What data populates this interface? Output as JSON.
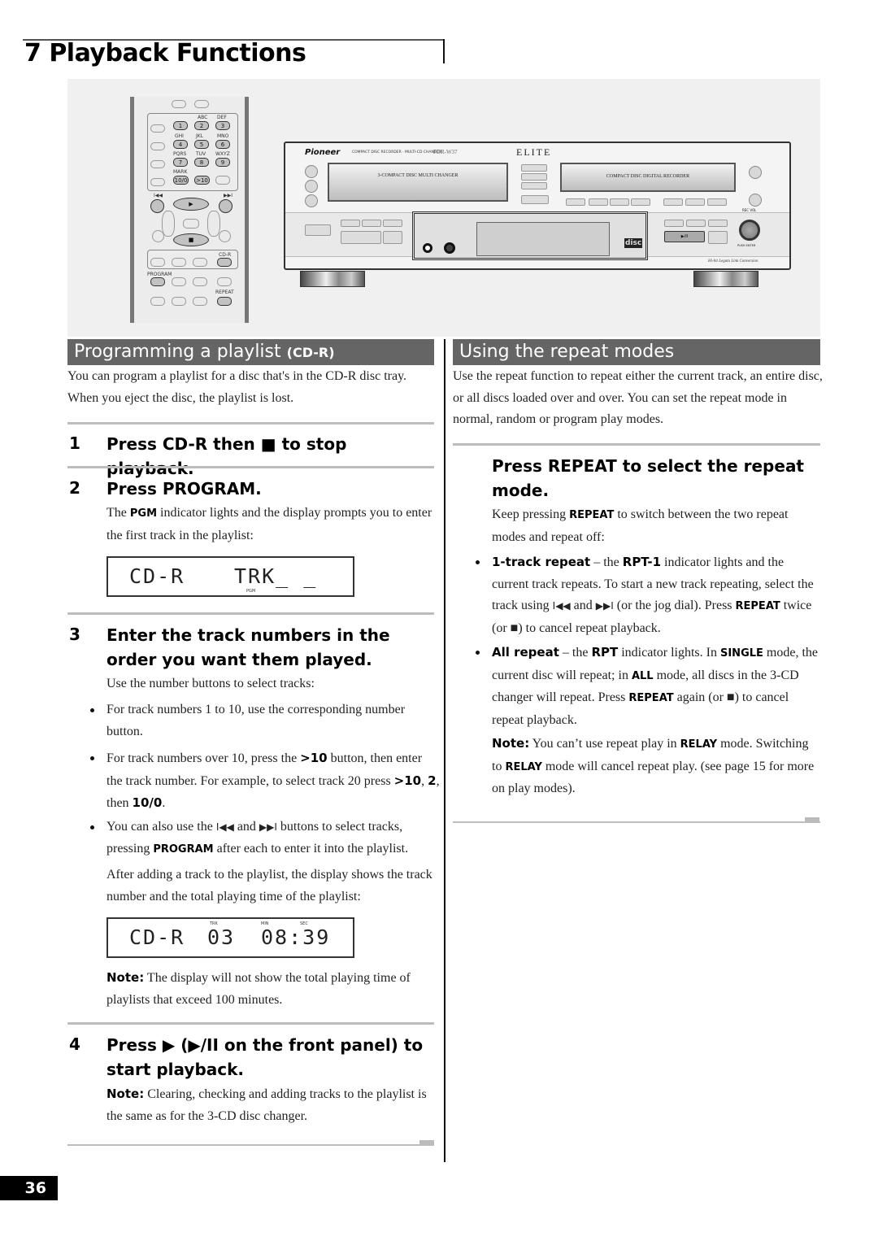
{
  "chapter": {
    "title": "7 Playback Functions"
  },
  "illustration": {
    "remote": {
      "letter_labels": [
        "ABC",
        "DEF",
        "GHI",
        "JKL",
        "MNO",
        "PQRS",
        "TUV",
        "WXYZ"
      ],
      "number_keys": [
        "1",
        "2",
        "3",
        "4",
        "5",
        "6",
        "7",
        "8",
        "9",
        "10/0",
        ">10"
      ],
      "mark_label": "MARK",
      "prev_label": "I◀◀",
      "next_label": "▶▶I",
      "play_label": "▶",
      "stop_label": "■",
      "cdr_label": "CD-R",
      "program_label": "PROGRAM",
      "repeat_label": "REPEAT"
    },
    "deck": {
      "brand": "Pioneer",
      "model_desc": "COMPACT DISC RECORDER · MULTI-CD CHANGER",
      "model": "PDR-W37",
      "elite": "ELITE",
      "changer_tray": "3-COMPACT DISC MULTI CHANGER",
      "recorder_tray": "COMPACT DISC DIGITAL RECORDER",
      "rec_vol": "REC VOL",
      "push_enter": "PUSH ENTER",
      "play_pause": "▶/II",
      "disc_logo": "disc",
      "legato": "Hi-bit Legato Link Conversion"
    }
  },
  "left": {
    "section_title": "Programming a playlist",
    "section_tag": "(CD-R)",
    "intro": "You can program a playlist for a disc that's in the CD-R disc tray. When you eject the disc, the playlist is lost.",
    "steps": [
      {
        "num": "1",
        "title": "Press CD-R then ■ to stop playback."
      },
      {
        "num": "2",
        "title": "Press PROGRAM.",
        "body_pre": "The ",
        "body_bold": "PGM",
        "body_post": " indicator lights and the display prompts you to enter the first track in the playlist:"
      },
      {
        "num": "3",
        "title": "Enter the track numbers in the order you want them played.",
        "body": "Use the number buttons to select tracks:",
        "bullets": [
          {
            "text": "For track numbers 1 to 10, use the corresponding number button."
          },
          {
            "p1": "For track numbers over 10, press the ",
            "b1": ">10",
            "p2": " button, then enter the track number. For example, to select track 20 press ",
            "b2": ">10",
            "p3": ", ",
            "b3": "2",
            "p4": ", then ",
            "b4": "10/0",
            "p5": "."
          },
          {
            "p1": "You can also use the ",
            "i1": "I◀◀",
            "p2": " and ",
            "i2": "▶▶I",
            "p3": " buttons to select tracks, pressing ",
            "b1": "PROGRAM",
            "p4": " after each to enter it into the playlist."
          }
        ],
        "after": "After adding a track to the playlist, the display shows the track number and the total playing time of the playlist:",
        "note_label": "Note:",
        "note": " The display will not show the total playing time of playlists that exceed 100 minutes."
      },
      {
        "num": "4",
        "title": "Press ▶ (▶/II on the front panel) to start playback.",
        "note_label": "Note:",
        "note": " Clearing, checking and adding tracks to the playlist is the same as for the 3-CD disc changer."
      }
    ],
    "lcd1": {
      "left": "CD-R",
      "right": "TRK_ _",
      "indicator": "PGM"
    },
    "lcd2": {
      "left": "CD-R",
      "track": "03",
      "time": "08:39",
      "trk_label": "TRK",
      "min_label": "MIN",
      "sec_label": "SEC"
    }
  },
  "right": {
    "section_title": "Using the repeat modes",
    "intro": "Use the repeat function to repeat either the current track, an entire disc, or all discs loaded over and over. You can set the repeat mode in normal, random or program play modes.",
    "step_title": "Press REPEAT to select the repeat mode.",
    "body_pre": "Keep pressing ",
    "body_bold": "REPEAT",
    "body_post": " to switch between the two repeat modes and repeat off:",
    "bullets": [
      {
        "lead": "1-track repeat",
        "p1": " – the ",
        "b1": "RPT-1",
        "p2": " indicator lights and the current track repeats. To start a new track repeating, select the track using ",
        "i1": "I◀◀",
        "p3": " and ",
        "i2": "▶▶I",
        "p4": " (or the jog dial). Press ",
        "b2": "REPEAT",
        "p5": " twice (or ■) to cancel repeat playback."
      },
      {
        "lead": "All repeat",
        "p1": " – the ",
        "b1": "RPT",
        "p2": " indicator lights. In ",
        "b2": "SINGLE",
        "p3": " mode, the current disc will repeat; in ",
        "b3": "ALL",
        "p4": " mode, all discs in the 3-CD changer will repeat. Press ",
        "b4": "REPEAT",
        "p5": " again (or ■) to cancel repeat playback."
      }
    ],
    "note_label": "Note:",
    "note_p1": " You can’t use repeat play in ",
    "note_b1": "RELAY",
    "note_p2": " mode. Switching to ",
    "note_b2": "RELAY",
    "note_p3": " mode will cancel repeat play. (see page 15 for more on play modes)."
  },
  "footer": {
    "page_number": "36"
  }
}
